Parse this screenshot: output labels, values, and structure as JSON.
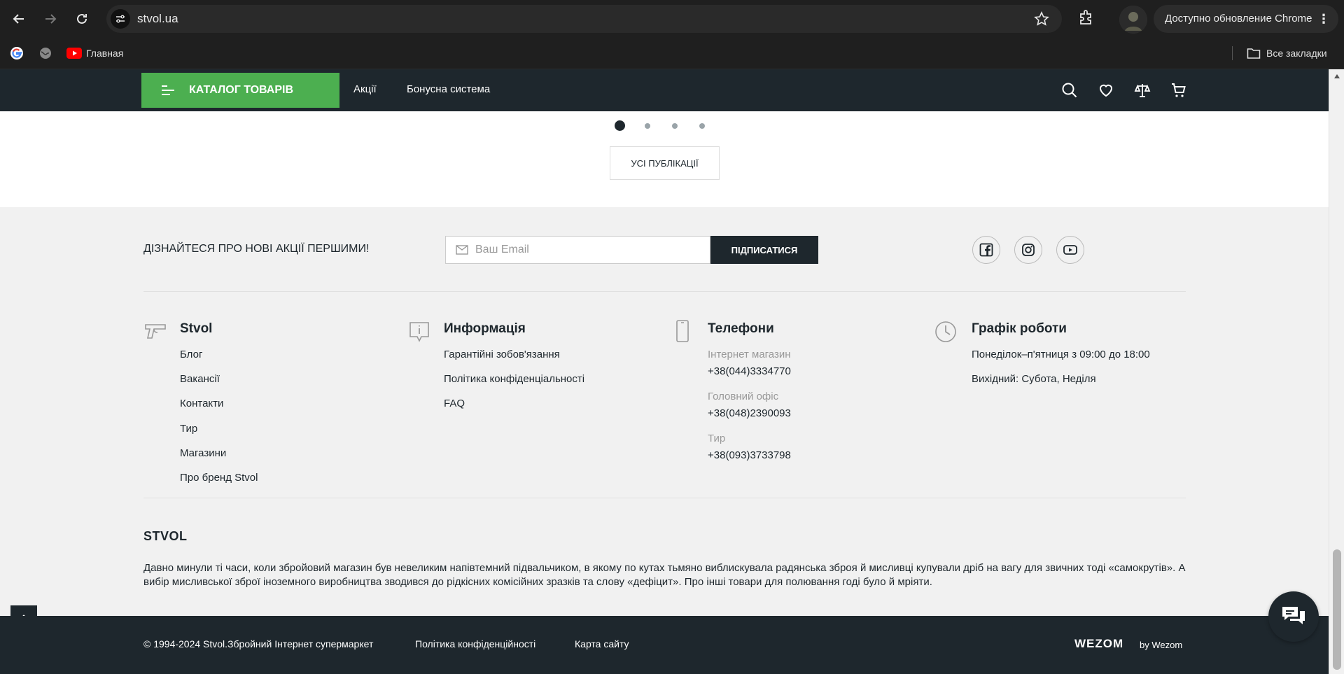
{
  "browser": {
    "url": "stvol.ua",
    "update_label": "Доступно обновление Chrome",
    "bookmarks": {
      "youtube_label": "Главная",
      "all_bookmarks_label": "Все закладки"
    }
  },
  "header": {
    "catalog_label": "КАТАЛОГ ТОВАРІВ",
    "links": [
      "Акції",
      "Бонусна система"
    ]
  },
  "slider": {
    "dots_count": 4,
    "active_dot": 1,
    "all_publications_label": "УСІ ПУБЛІКАЦІЇ"
  },
  "subscribe": {
    "title": "ДІЗНАЙТЕСЯ ПРО НОВІ АКЦІЇ ПЕРШИМИ!",
    "placeholder": "Ваш Email",
    "button_label": "ПІДПИСАТИСЯ"
  },
  "columns": {
    "stvol": {
      "title": "Stvol",
      "links": [
        "Блог",
        "Вакансії",
        "Контакти",
        "Тир",
        "Магазини",
        "Про бренд Stvol"
      ]
    },
    "info": {
      "title": "Информація",
      "links": [
        "Гарантійні зобов'язання",
        "Політика конфіденціальності",
        "FAQ"
      ]
    },
    "phones": {
      "title": "Телефони",
      "items": [
        {
          "label": "Інтернет магазин",
          "phone": "+38(044)3334770"
        },
        {
          "label": "Головний офіс",
          "phone": "+38(048)2390093"
        },
        {
          "label": "Тир",
          "phone": "+38(093)3733798"
        }
      ]
    },
    "schedule": {
      "title": "Графік роботи",
      "lines": [
        "Понеділок–п'ятниця з 09:00 до 18:00",
        "Вихідний: Субота, Неділя"
      ]
    }
  },
  "brand": {
    "title": "STVOL",
    "text": "Давно минули ті часи, коли збройовий магазин був невеликим напівтемний підвальчиком, в якому по кутах тьмяно виблискувала радянська зброя й мисливці купували дріб на вагу для звичних тоді «самокрутів». А вибір мисливської зброї іноземного виробництва зводився до рідкісних комісійних зразків та слову «дефіцит». Про інші товари для полювання годі було й мріяти."
  },
  "footer": {
    "copyright": "© 1994-2024 Stvol.Збройний Інтернет супермаркет",
    "privacy_label": "Політика конфіденційності",
    "sitemap_label": "Карта сайту",
    "wezom_logo": "WEZOM",
    "by_wezom": "by Wezom"
  },
  "colors": {
    "accent_green": "#4caf50",
    "dark": "#1e272d",
    "footer_bg": "#f1f1f1"
  },
  "icons": [
    "back-icon",
    "forward-icon",
    "reload-icon",
    "site-settings-icon",
    "star-icon",
    "extensions-icon",
    "menu-dots-icon",
    "google-icon",
    "globe-icon",
    "youtube-icon",
    "folder-icon",
    "burger-icon",
    "search-icon",
    "heart-icon",
    "compare-icon",
    "cart-icon",
    "mail-icon",
    "facebook-icon",
    "instagram-icon",
    "youtube-social-icon",
    "gun-icon",
    "info-icon",
    "phone-icon",
    "clock-icon",
    "arrow-up-icon",
    "chat-icon"
  ]
}
